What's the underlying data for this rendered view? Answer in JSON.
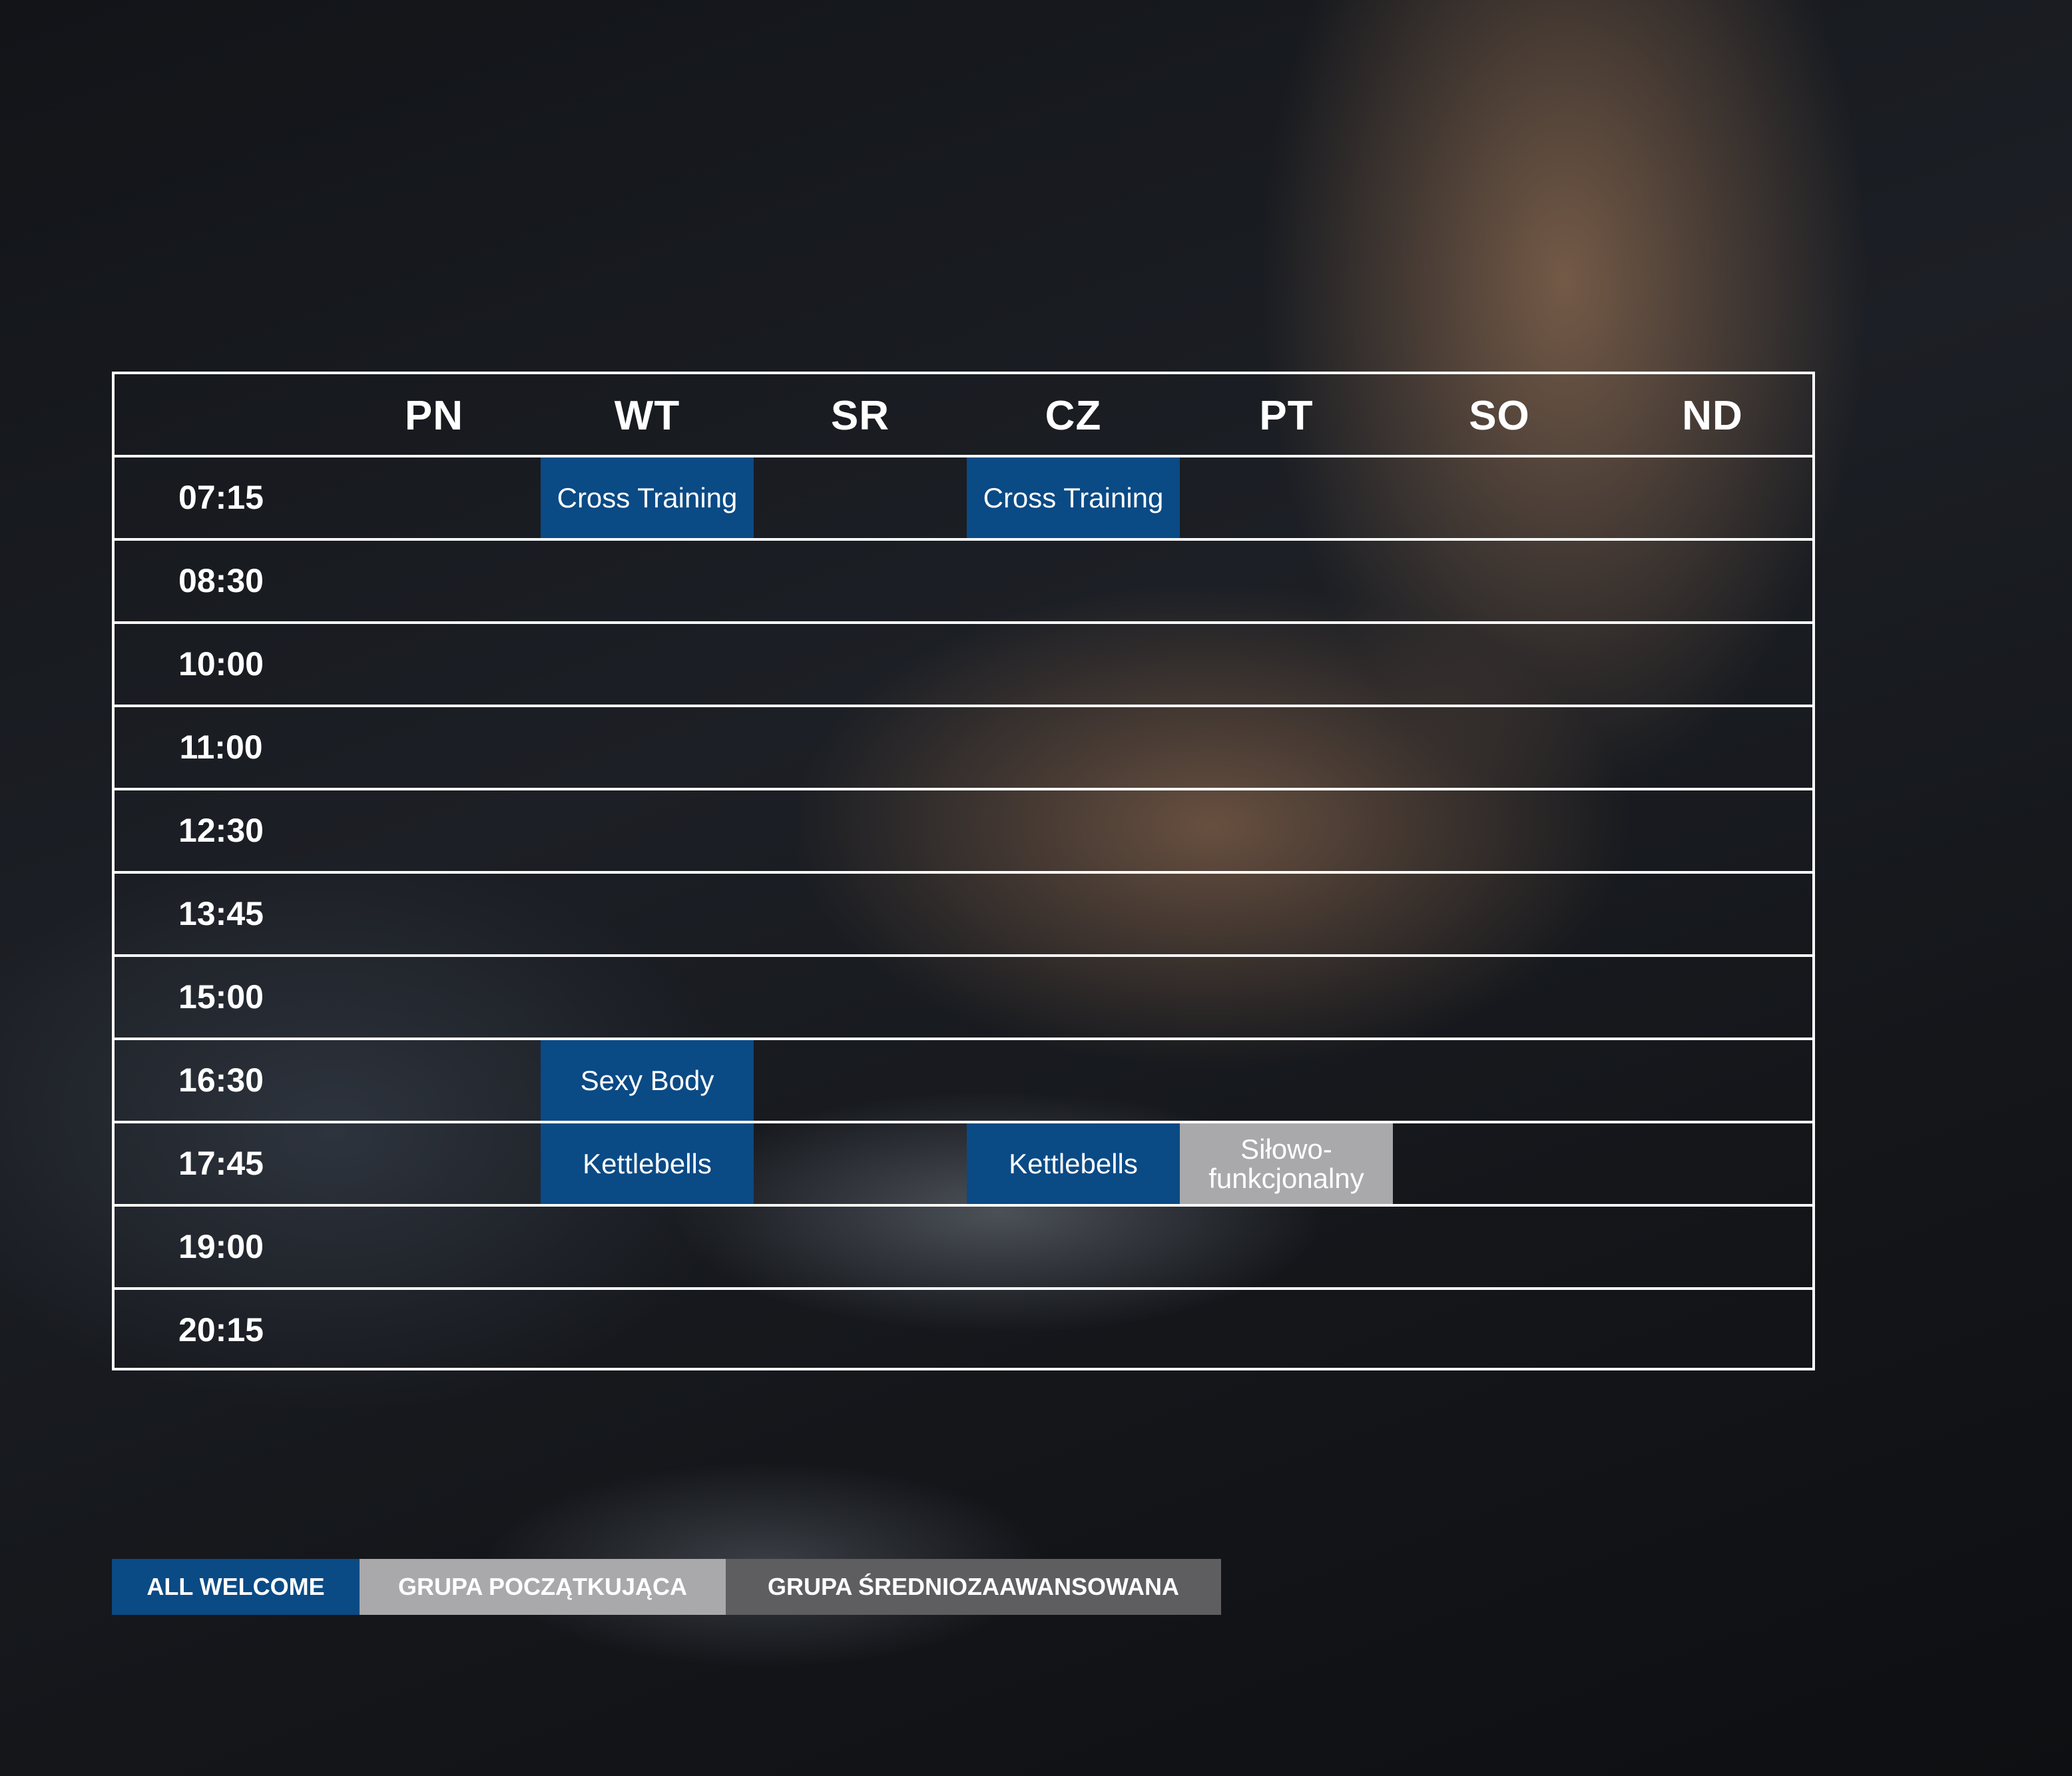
{
  "colors": {
    "all_welcome": "#0a4a85",
    "beginner": "#a9a9ab",
    "intermediate": "#5e5e60"
  },
  "days": [
    "PN",
    "WT",
    "SR",
    "CZ",
    "PT",
    "SO",
    "ND"
  ],
  "times": [
    "07:15",
    "08:30",
    "10:00",
    "11:00",
    "12:30",
    "13:45",
    "15:00",
    "16:30",
    "17:45",
    "19:00",
    "20:15"
  ],
  "sessions": {
    "s0715_wt": "Cross Training",
    "s0715_cz": "Cross Training",
    "s1630_wt": "Sexy Body",
    "s1745_wt": "Kettlebells",
    "s1745_cz": "Kettlebells",
    "s1745_pt_line1": "Siłowo-",
    "s1745_pt_line2": "funkcjonalny"
  },
  "legend": {
    "all_welcome": "ALL WELCOME",
    "beginner": "GRUPA POCZĄTKUJĄCA",
    "intermediate": "GRUPA ŚREDNIOZAAWANSOWANA"
  }
}
